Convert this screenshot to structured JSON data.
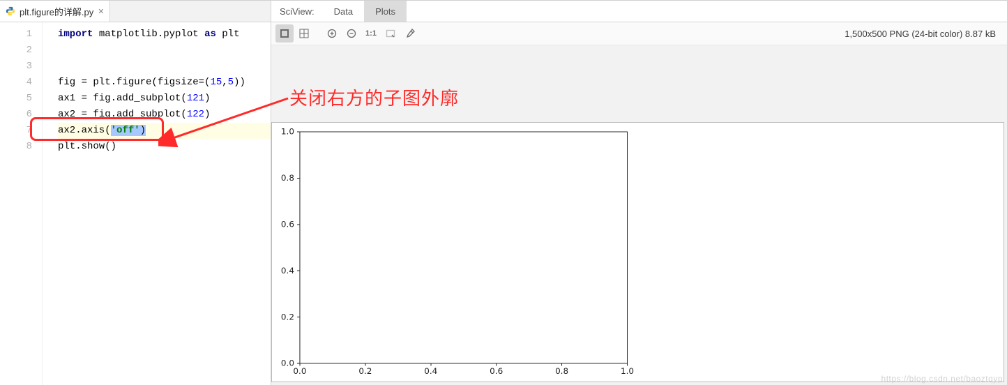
{
  "editor": {
    "tab_filename": "plt.figure的详解.py",
    "lines": [
      {
        "n": 1
      },
      {
        "n": 2
      },
      {
        "n": 3
      },
      {
        "n": 4
      },
      {
        "n": 5
      },
      {
        "n": 6
      },
      {
        "n": 7
      },
      {
        "n": 8
      }
    ],
    "code": {
      "kw_import": "import",
      "mpl": " matplotlib.pyplot ",
      "kw_as": "as",
      "plt": " plt",
      "l4a": "fig = plt.figure(figsize=(",
      "l4n1": "15",
      "l4c": ",",
      "l4n2": "5",
      "l4b": "))",
      "l5a": "ax1 = fig.add_subplot(",
      "l5n": "121",
      "l5b": ")",
      "l6a": "ax2 = fig.add_subplot(",
      "l6n": "122",
      "l6b": ")",
      "l7a": "ax2.axis(",
      "l7s": "'off'",
      "l7b": ")",
      "l8": "plt.show()"
    }
  },
  "sciview": {
    "label": "SciView:",
    "tab_data": "Data",
    "tab_plots": "Plots",
    "img_info": "1,500x500 PNG (24-bit color) 8.87 kB",
    "icons": {
      "fit": "fit-icon",
      "grid": "grid-icon",
      "zoom_in": "zoom-in-icon",
      "zoom_out": "zoom-out-icon",
      "one_to_one": "one-to-one-icon",
      "bounds": "bounds-icon",
      "picker": "color-picker-icon"
    },
    "one_to_one_label": "1:1"
  },
  "annotation": {
    "text": "关闭右方的子图外廓"
  },
  "chart_data": {
    "type": "line",
    "series": [],
    "title": "",
    "xlabel": "",
    "ylabel": "",
    "xlim": [
      0.0,
      1.0
    ],
    "ylim": [
      0.0,
      1.0
    ],
    "xticks": [
      0.0,
      0.2,
      0.4,
      0.6,
      0.8,
      1.0
    ],
    "yticks": [
      0.0,
      0.2,
      0.4,
      0.6,
      0.8,
      1.0
    ],
    "note": "right subplot axis turned off; left subplot shown with frame only, no data"
  },
  "watermark": "https://blog.csdn.net/baoztqyp"
}
